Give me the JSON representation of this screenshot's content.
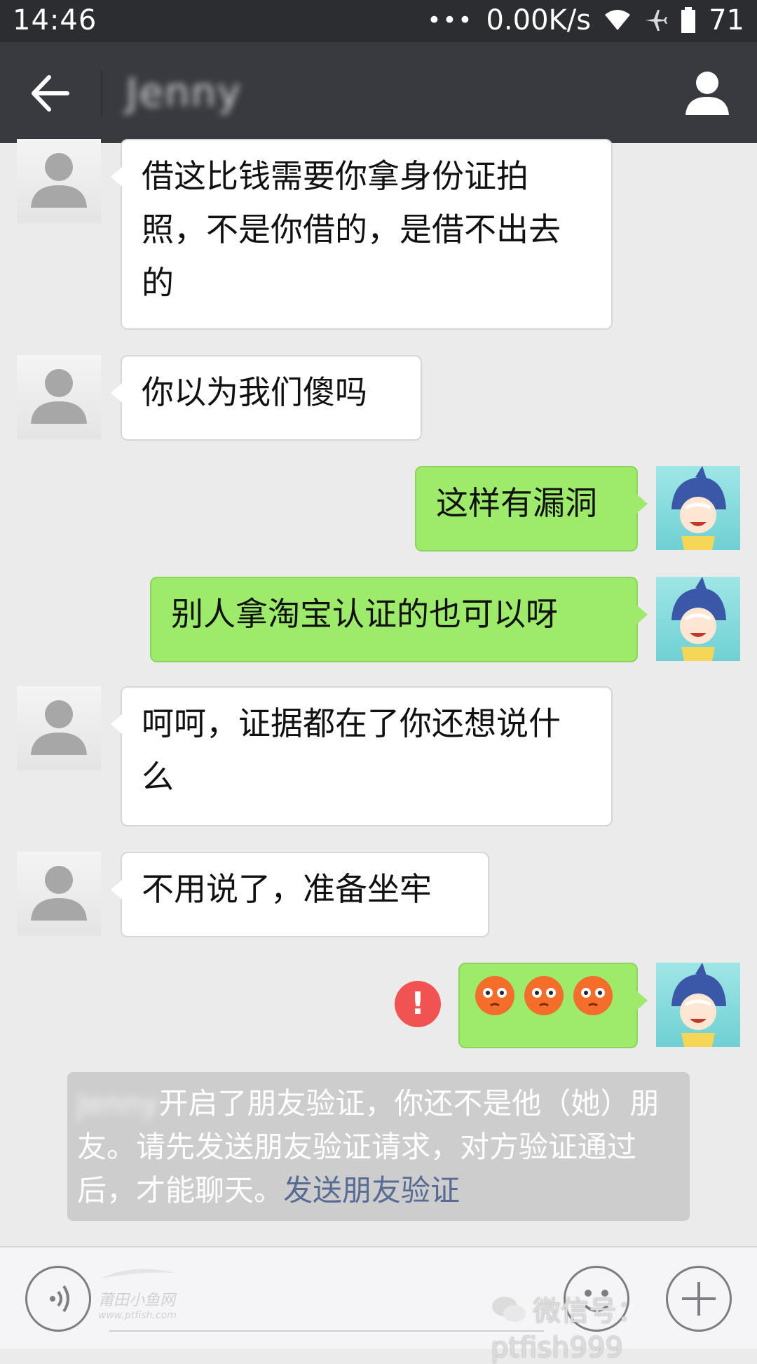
{
  "status_bar": {
    "time": "14:46",
    "dots": "•••",
    "speed": "0.00K/s",
    "battery": "71"
  },
  "nav": {
    "contact_name": "Jenny"
  },
  "messages": [
    {
      "side": "in",
      "text": "借这比钱需要你拿身份证拍照，不是你借的，是借不出去的"
    },
    {
      "side": "in",
      "text": "你以为我们傻吗"
    },
    {
      "side": "out",
      "text": "这样有漏洞"
    },
    {
      "side": "out",
      "text": "别人拿淘宝认证的也可以呀"
    },
    {
      "side": "in",
      "text": "呵呵，证据都在了你还想说什么"
    },
    {
      "side": "in",
      "text": "不用说了，准备坐牢"
    },
    {
      "side": "out",
      "type": "emoji",
      "emoji_icon": "flushed-emoji",
      "count": 3,
      "status": "!"
    }
  ],
  "system_notice": {
    "blurred_name": "Jenny",
    "text": "开启了朋友验证，你还不是他（她）朋友。请先发送朋友验证请求，对方验证通过后，才能聊天。",
    "link": "发送朋友验证"
  },
  "watermark": {
    "logo_text": "莆田小鱼网",
    "logo_url": "www.ptfish.com",
    "account": "微信号：ptfish999"
  },
  "colors": {
    "status_bar_bg": "#2c2d31",
    "nav_bg": "#393a3f",
    "chat_bg": "#ebebeb",
    "bubble_out": "#9eea6a",
    "bubble_in": "#ffffff",
    "error": "#f05352",
    "link": "#576b95"
  }
}
